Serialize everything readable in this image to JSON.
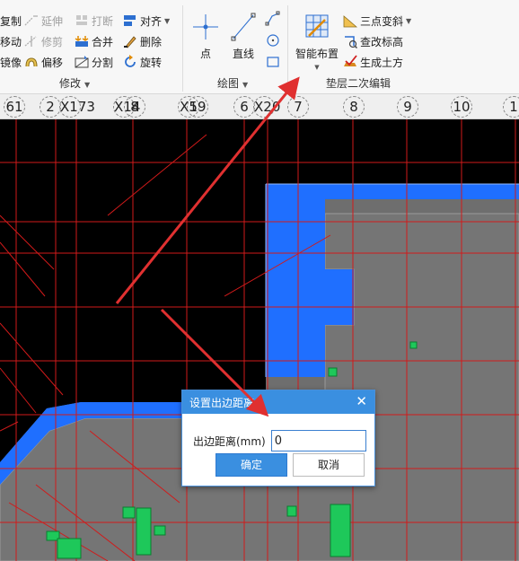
{
  "ribbon": {
    "modify_group": {
      "label": "修改",
      "items": [
        {
          "id": "copy",
          "label": "复制",
          "icon": "copy-icon",
          "enabled": true
        },
        {
          "id": "extend",
          "label": "延伸",
          "icon": "extend-icon",
          "enabled": false
        },
        {
          "id": "break",
          "label": "打断",
          "icon": "break-icon",
          "enabled": false
        },
        {
          "id": "align",
          "label": "对齐",
          "icon": "align-icon",
          "enabled": true
        },
        {
          "id": "move",
          "label": "移动",
          "icon": "move-icon",
          "enabled": true
        },
        {
          "id": "trim",
          "label": "修剪",
          "icon": "trim-icon",
          "enabled": false
        },
        {
          "id": "merge",
          "label": "合并",
          "icon": "merge-icon",
          "enabled": true
        },
        {
          "id": "delete",
          "label": "删除",
          "icon": "delete-icon",
          "enabled": true
        },
        {
          "id": "mirror",
          "label": "镜像",
          "icon": "mirror-icon",
          "enabled": true
        },
        {
          "id": "offset",
          "label": "偏移",
          "icon": "offset-icon",
          "enabled": true
        },
        {
          "id": "split",
          "label": "分割",
          "icon": "split-icon",
          "enabled": true
        },
        {
          "id": "rotate",
          "label": "旋转",
          "icon": "rotate-icon",
          "enabled": true
        }
      ]
    },
    "draw_group": {
      "label": "绘图",
      "point": "点",
      "line": "直线"
    },
    "cushion_group": {
      "label": "垫层二次编辑",
      "smart_layout": "智能布置",
      "three_point_slope": "三点变斜",
      "check_elevation": "查改标高",
      "generate_earthwork": "生成土方"
    }
  },
  "axis_labels": [
    {
      "text": "61"
    },
    {
      "text": "2"
    },
    {
      "text": "X173"
    },
    {
      "text": "X14"
    },
    {
      "text": "8"
    },
    {
      "text": "X5"
    },
    {
      "text": "19"
    },
    {
      "text": "6"
    },
    {
      "text": "X20"
    },
    {
      "text": "7"
    },
    {
      "text": "8"
    },
    {
      "text": "9"
    },
    {
      "text": "10"
    },
    {
      "text": "1"
    }
  ],
  "dialog": {
    "title": "设置出边距离",
    "field_label": "出边距离(mm)",
    "field_value": "0",
    "ok": "确定",
    "cancel": "取消"
  },
  "colors": {
    "grid": "#d11a1a",
    "slab_fill": "#6e6e6e",
    "edge": "#1f6fff",
    "element": "#1ec85a",
    "arrow": "#e03030",
    "dialog_accent": "#3a8fe0"
  }
}
